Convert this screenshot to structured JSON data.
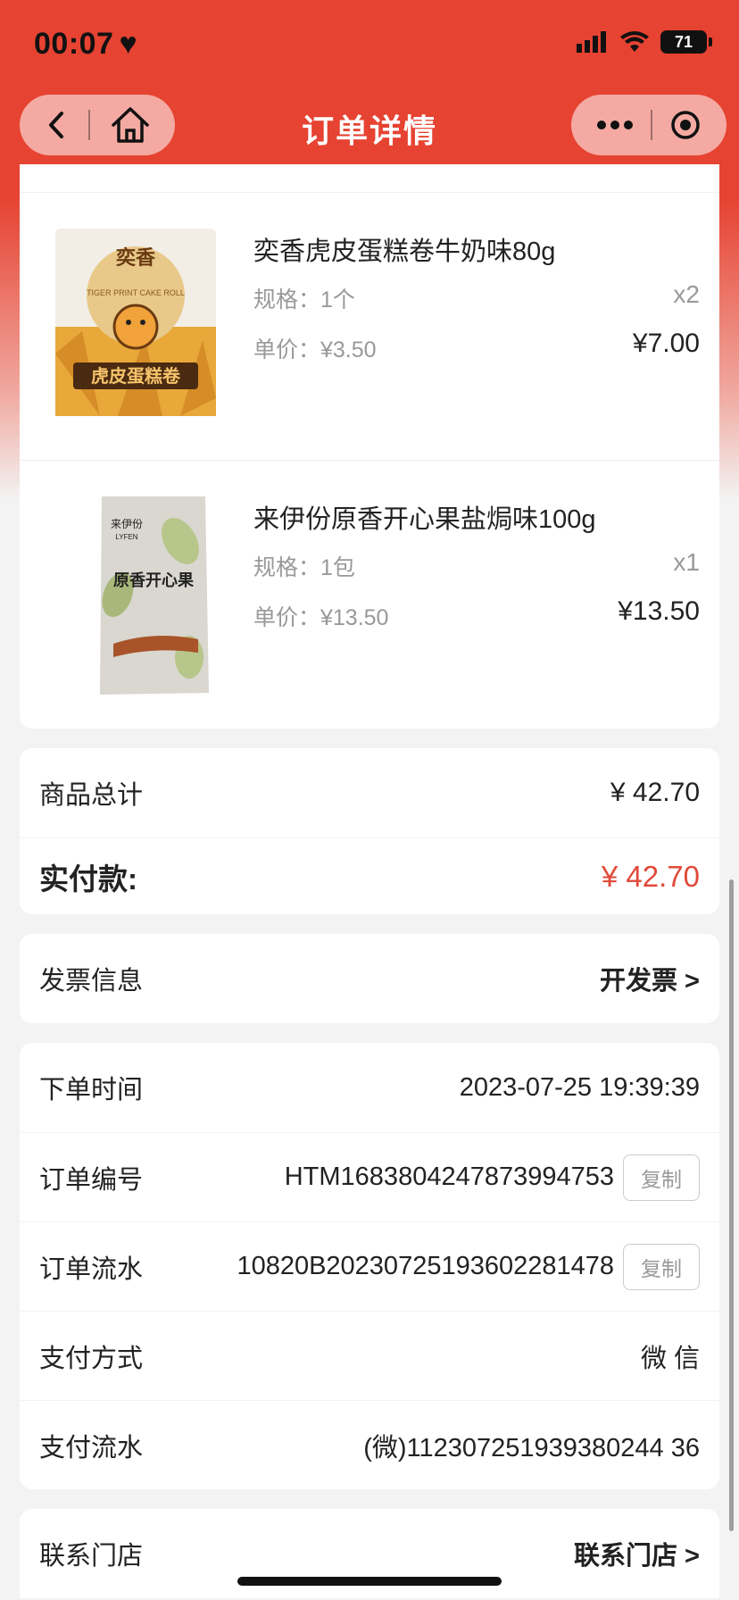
{
  "status": {
    "time": "00:07",
    "battery": "71"
  },
  "nav": {
    "title": "订单详情"
  },
  "products": [
    {
      "name": "奕香虎皮蛋糕卷牛奶味80g",
      "spec": "规格：1个",
      "qty": "x2",
      "unit_price": "单价：¥3.50",
      "total": "¥7.00",
      "image_brand": "奕香",
      "image_text": "虎皮蛋糕卷",
      "image_sub": "TIGER PRINT CAKE ROLL"
    },
    {
      "name": "来伊份原香开心果盐焗味100g",
      "spec": "规格：1包",
      "qty": "x1",
      "unit_price": "单价：¥13.50",
      "total": "¥13.50",
      "image_brand": "来伊份",
      "image_brand_en": "LYFEN",
      "image_text": "原香开心果"
    }
  ],
  "summary": {
    "goods_total_label": "商品总计",
    "goods_total_value": "¥ 42.70",
    "paid_label": "实付款:",
    "paid_value": "¥ 42.70"
  },
  "invoice": {
    "label": "发票信息",
    "action": "开发票 >"
  },
  "order_info": {
    "time_label": "下单时间",
    "time_value": "2023-07-25 19:39:39",
    "number_label": "订单编号",
    "number_value": "HTM1683804247873994753",
    "serial_label": "订单流水",
    "serial_value": "10820B20230725193602281478",
    "copy_label": "复制",
    "pay_method_label": "支付方式",
    "pay_method_value": "微 信",
    "pay_serial_label": "支付流水",
    "pay_serial_value": "(微)112307251939380244 36"
  },
  "store": {
    "label": "联系门店",
    "action": "联系门店 >"
  },
  "colors": {
    "accent": "#e64332",
    "paid": "#e04a39"
  }
}
